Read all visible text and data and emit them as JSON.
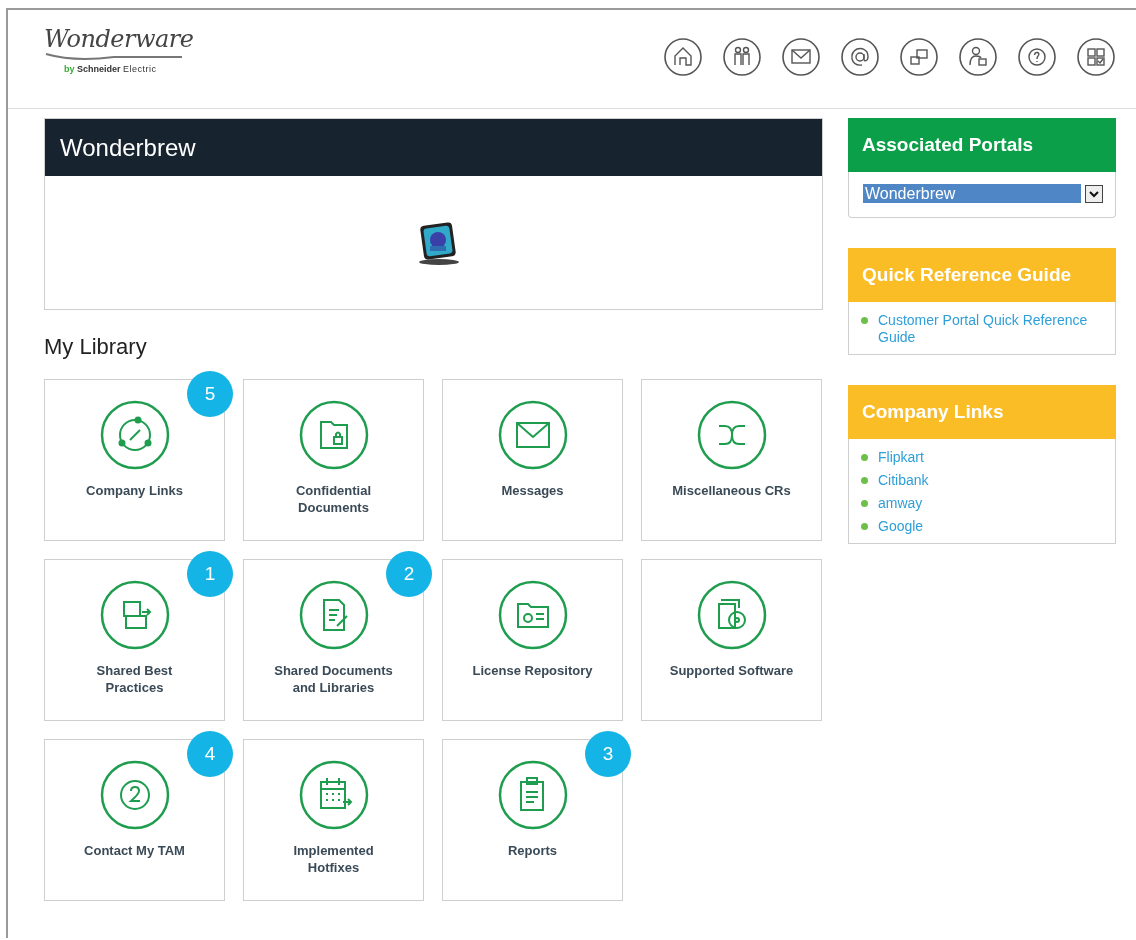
{
  "logo": {
    "name": "Wonderware",
    "tagline_prefix": "by",
    "tagline_brand": "Schneider",
    "tagline_suffix": "Electric"
  },
  "banner": {
    "title": "Wonderbrew"
  },
  "library": {
    "title": "My Library",
    "tiles": [
      {
        "label": "Company Links",
        "badge": "5"
      },
      {
        "label": "Confidential Documents"
      },
      {
        "label": "Messages"
      },
      {
        "label": "Miscellaneous CRs"
      },
      {
        "label": "Shared Best Practices",
        "badge": "1"
      },
      {
        "label": "Shared Documents and Libraries",
        "badge": "2"
      },
      {
        "label": "License Repository"
      },
      {
        "label": "Supported Software"
      },
      {
        "label": "Contact My TAM",
        "badge": "4"
      },
      {
        "label": "Implemented Hotfixes"
      },
      {
        "label": "Reports",
        "badge": "3"
      }
    ]
  },
  "sidebar": [
    {
      "kind": "select",
      "title": "Associated Portals",
      "color": "#0a9f48",
      "value": "Wonderbrew"
    },
    {
      "kind": "links",
      "title": "Quick Reference Guide",
      "color": "#fbbd26",
      "links": [
        "Customer Portal Quick Reference Guide"
      ]
    },
    {
      "kind": "links",
      "title": "Company Links",
      "color": "#fbbd26",
      "links": [
        "Flipkart",
        "Citibank",
        "amway",
        "Google"
      ]
    }
  ]
}
